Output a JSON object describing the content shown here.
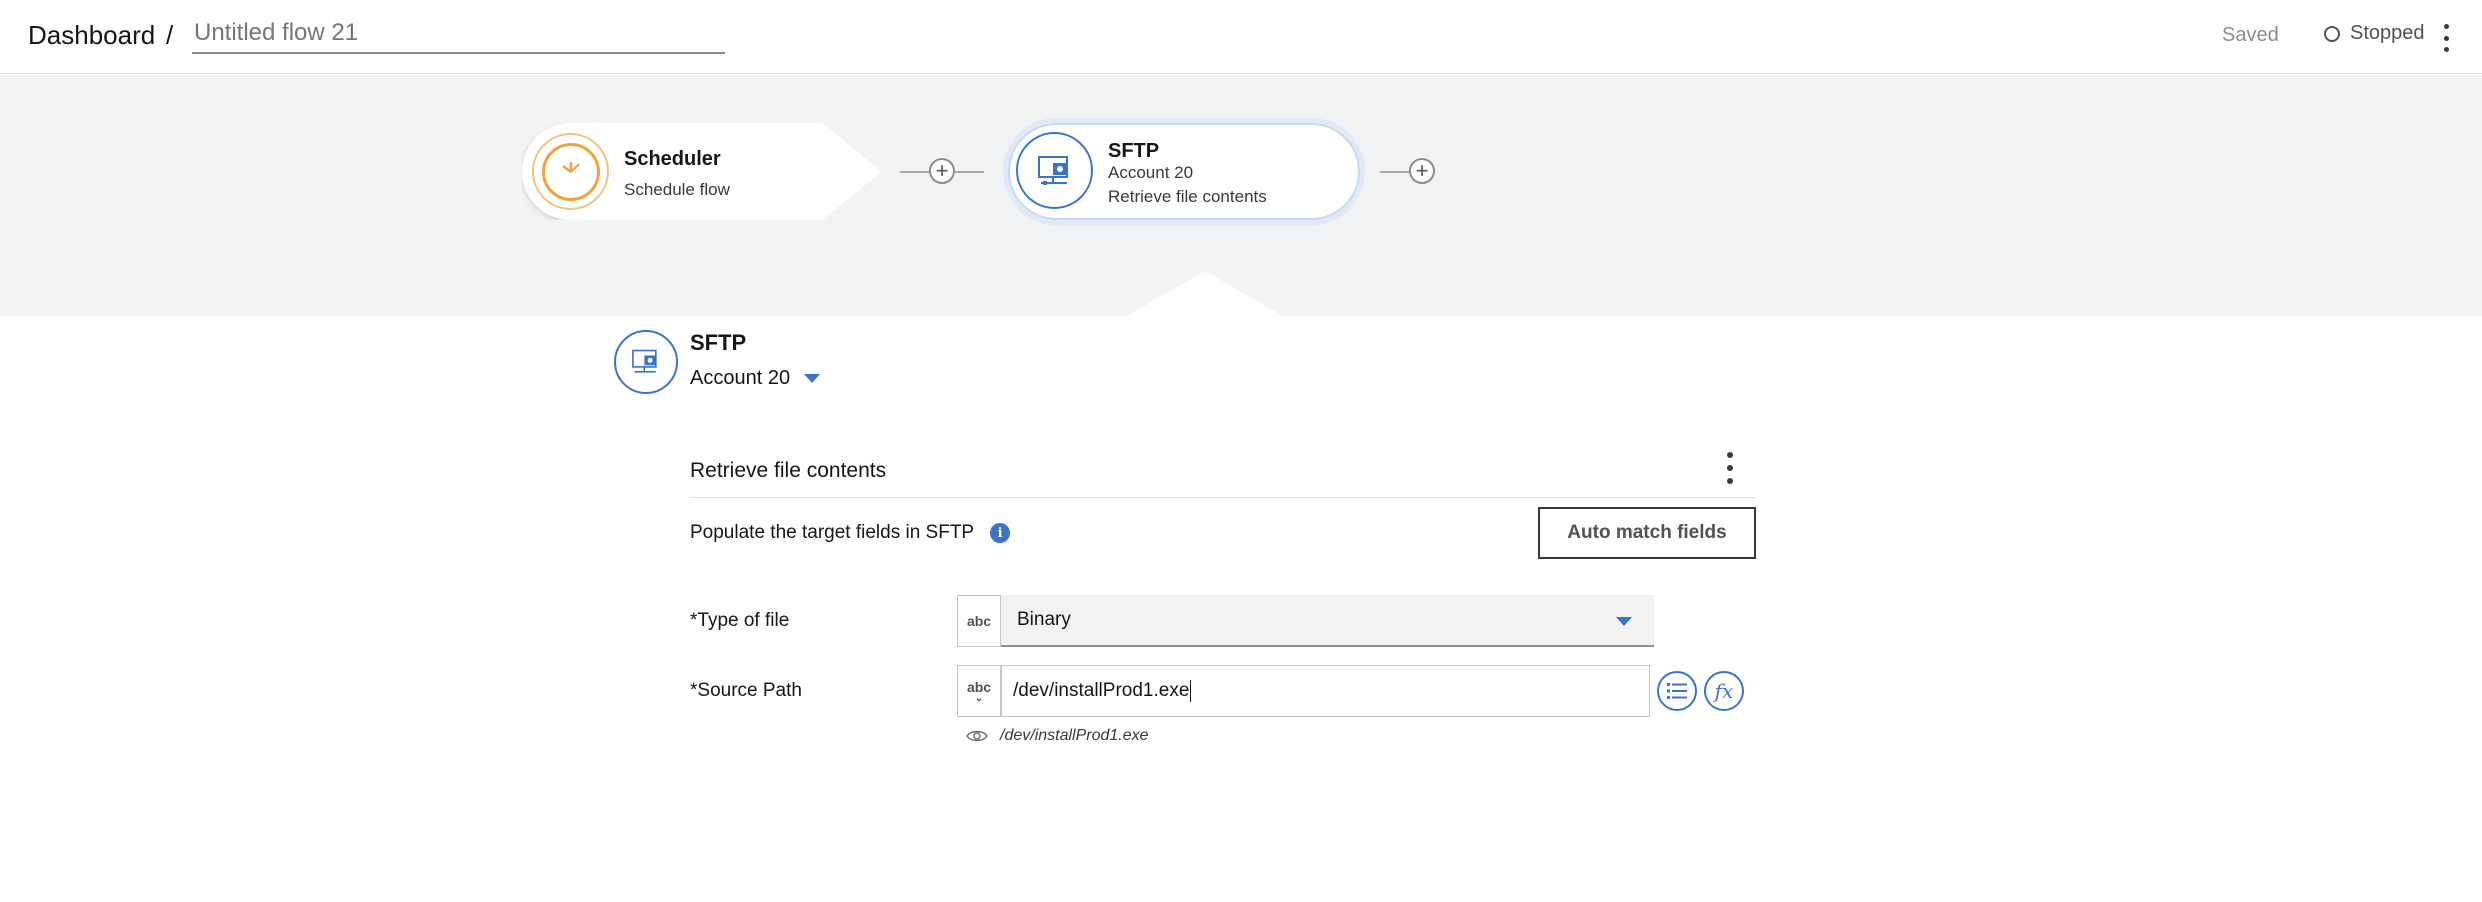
{
  "header": {
    "breadcrumb": "Dashboard",
    "separator": "/",
    "flow_name": "Untitled flow 21",
    "saved_label": "Saved",
    "status_label": "Stopped"
  },
  "flow": {
    "nodes": [
      {
        "title": "Scheduler",
        "subtitle": "Schedule flow",
        "icon": "clock-icon"
      },
      {
        "title": "SFTP",
        "account": "Account 20",
        "action": "Retrieve file contents",
        "icon": "sftp-folder-icon"
      }
    ]
  },
  "panel": {
    "app_title": "SFTP",
    "account": "Account 20",
    "section_title": "Retrieve file contents",
    "populate_text": "Populate the target fields in SFTP",
    "auto_match_label": "Auto match fields",
    "fields": [
      {
        "label": "*Type of file",
        "type_badge": "abc",
        "value": "Binary"
      },
      {
        "label": "*Source Path",
        "type_badge": "abc",
        "value": "/dev/installProd1.exe",
        "preview": "/dev/installProd1.exe"
      }
    ]
  },
  "colors": {
    "accent": "#3b73c7",
    "scheduler": "#f1a23a",
    "canvas_bg": "#f2f3f4"
  }
}
